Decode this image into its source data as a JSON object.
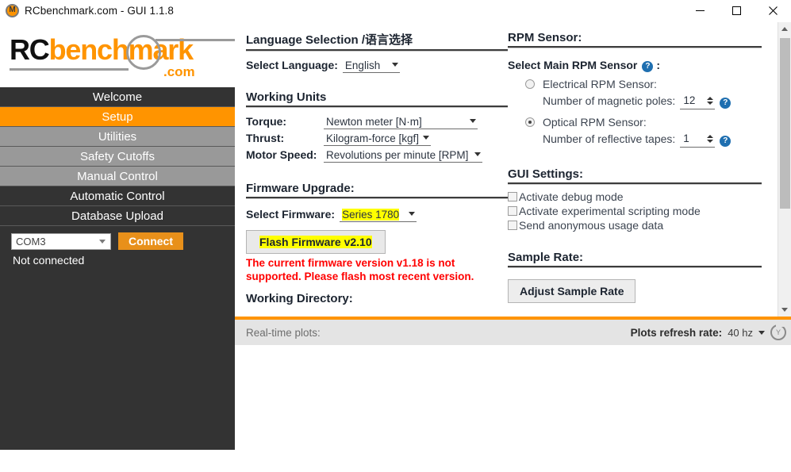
{
  "window": {
    "title": "RCbenchmark.com - GUI 1.1.8",
    "app_icon": "rcbenchmark-logo-icon",
    "minimize_label": "minimize-icon",
    "maximize_label": "maximize-icon",
    "close_label": "close-icon"
  },
  "brand": {
    "part1": "RC",
    "part2": "bench",
    "part3": "m",
    "part4": "ark",
    "suffix": ".com"
  },
  "sidebar": {
    "items": [
      {
        "label": "Welcome",
        "state": "dark"
      },
      {
        "label": "Setup",
        "state": "active"
      },
      {
        "label": "Utilities",
        "state": "gray"
      },
      {
        "label": "Safety Cutoffs",
        "state": "gray"
      },
      {
        "label": "Manual Control",
        "state": "gray"
      },
      {
        "label": "Automatic Control",
        "state": "dark"
      },
      {
        "label": "Database Upload",
        "state": "dark"
      }
    ],
    "port_value": "COM3",
    "connect_label": "Connect",
    "connection_status": "Not connected"
  },
  "language_section": {
    "title": "Language Selection /语言选择",
    "select_label": "Select Language:",
    "selected": "English"
  },
  "working_units": {
    "title": "Working Units",
    "torque_label": "Torque:",
    "torque_value": "Newton meter [N·m]",
    "thrust_label": "Thrust:",
    "thrust_value": "Kilogram-force [kgf]",
    "speed_label": "Motor Speed:",
    "speed_value": "Revolutions per minute [RPM]"
  },
  "firmware": {
    "title": "Firmware Upgrade:",
    "select_label": "Select Firmware:",
    "selected": "Series 1780",
    "flash_button": "Flash Firmware v2.10",
    "error_line1": "The current firmware version v1.18 is not",
    "error_line2": "supported. Please flash most recent version.",
    "working_directory_title": "Working Directory:"
  },
  "rpm_sensor": {
    "title": "RPM Sensor:",
    "select_main_label": "Select Main RPM Sensor",
    "select_main_suffix": ":",
    "help_glyph": "?",
    "electrical": {
      "label": "Electrical RPM Sensor:",
      "field_label": "Number of magnetic poles:",
      "value": "12",
      "selected": false
    },
    "optical": {
      "label": "Optical RPM Sensor:",
      "field_label": "Number of reflective tapes:",
      "value": "1",
      "selected": true
    }
  },
  "gui_settings": {
    "title": "GUI Settings:",
    "checkboxes": [
      {
        "label": "Activate debug mode",
        "checked": false
      },
      {
        "label": "Activate experimental scripting mode",
        "checked": false
      },
      {
        "label": "Send anonymous usage data",
        "checked": false
      }
    ]
  },
  "sample_rate": {
    "title": "Sample Rate:",
    "button_label": "Adjust Sample Rate"
  },
  "statusbar": {
    "realtime_label": "Real-time plots:",
    "refresh_label": "Plots refresh rate:",
    "refresh_value": "40 hz",
    "gauge_icon": "gauge-icon"
  },
  "colors": {
    "accent_orange": "#ff9400",
    "sidebar_dark": "#333333",
    "sidebar_gray": "#999999",
    "error_red": "#ff0000",
    "highlight_yellow": "#ffff00",
    "help_blue": "#1f6fb0"
  }
}
